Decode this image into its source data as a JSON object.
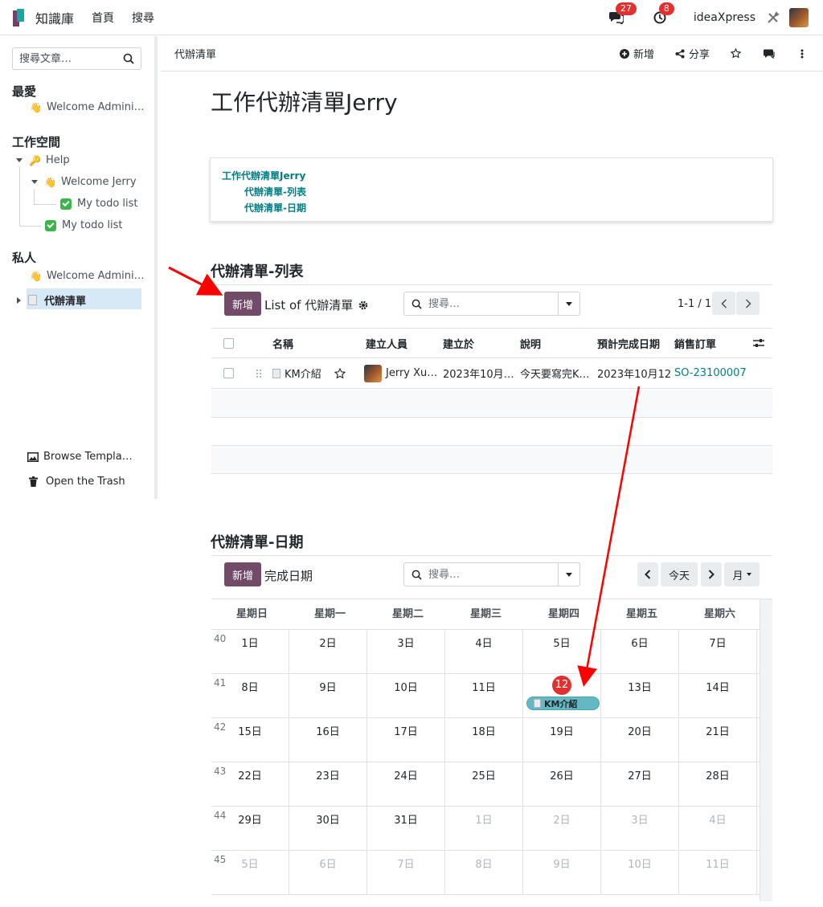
{
  "navbar": {
    "app_name": "知識庫",
    "menu": [
      "首頁",
      "搜尋"
    ],
    "messages_count": "27",
    "activities_count": "8",
    "company": "ideaXpress"
  },
  "sidebar": {
    "search_placeholder": "搜尋文章…",
    "favorites_title": "最愛",
    "favorites": [
      "Welcome Admini…"
    ],
    "workspace_title": "工作空間",
    "workspace": {
      "help": "Help",
      "welcome_jerry": "Welcome Jerry",
      "todo_child": "My todo list",
      "todo": "My todo list"
    },
    "private_title": "私人",
    "private": {
      "welcome_admin": "Welcome Admini…",
      "todo_list": "代辦清單"
    },
    "browse_templates": "Browse Templa…",
    "open_trash": "Open the Trash"
  },
  "crumbbar": {
    "breadcrumb": "代辦清單",
    "new_label": "新增",
    "share_label": "分享"
  },
  "article": {
    "title": "工作代辦清單Jerry",
    "toc": [
      "工作代辦清單Jerry",
      "代辦清單-列表",
      "代辦清單-日期"
    ]
  },
  "list_view": {
    "heading": "代辦清單-列表",
    "new_button": "新增",
    "view_name": "List of 代辦清單",
    "search_placeholder": "搜尋…",
    "pager": "1-1 / 1",
    "columns": [
      "名稱",
      "建立人員",
      "建立於",
      "說明",
      "預計完成日期",
      "銷售訂單"
    ],
    "rows": [
      {
        "name": "KM介紹",
        "created_by": "Jerry Xu…",
        "created_on": "2023年10月…",
        "description": "今天要寫完K…",
        "due_date": "2023年10月12",
        "sales_order": "SO-23100007"
      }
    ]
  },
  "calendar_view": {
    "heading": "代辦清單-日期",
    "new_button": "新增",
    "view_name": "完成日期",
    "search_placeholder": "搜尋…",
    "today_button": "今天",
    "scale_button": "月",
    "weekdays": [
      "星期日",
      "星期一",
      "星期二",
      "星期三",
      "星期四",
      "星期五",
      "星期六"
    ],
    "weeks": [
      {
        "num": "40",
        "days": [
          "1日",
          "2日",
          "3日",
          "4日",
          "5日",
          "6日",
          "7日"
        ]
      },
      {
        "num": "41",
        "days": [
          "8日",
          "9日",
          "10日",
          "11日",
          "12日",
          "13日",
          "14日"
        ]
      },
      {
        "num": "42",
        "days": [
          "15日",
          "16日",
          "17日",
          "18日",
          "19日",
          "20日",
          "21日"
        ]
      },
      {
        "num": "43",
        "days": [
          "22日",
          "23日",
          "24日",
          "25日",
          "26日",
          "27日",
          "28日"
        ]
      },
      {
        "num": "44",
        "days": [
          "29日",
          "30日",
          "31日",
          "1日",
          "2日",
          "3日",
          "4日"
        ]
      },
      {
        "num": "45",
        "days": [
          "5日",
          "6日",
          "7日",
          "8日",
          "9日",
          "10日",
          "11日"
        ]
      }
    ],
    "event": "KM介紹"
  },
  "colors": {
    "primary": "#714b67",
    "link": "#017e84",
    "today": "#e03131",
    "event": "#63b8c4",
    "annotation_arrow": "#ff0000"
  }
}
